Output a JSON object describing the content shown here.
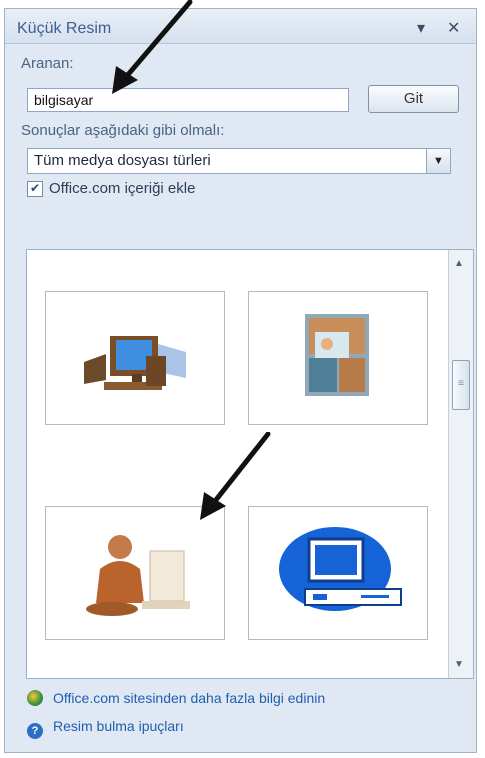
{
  "pane": {
    "title": "Küçük Resim",
    "dropdown_icon": "triangle-down-icon",
    "close_icon": "close-icon"
  },
  "search": {
    "label": "Aranan:",
    "value": "bilgisayar",
    "go_label": "Git"
  },
  "results_filter": {
    "label": "Sonuçlar aşağıdaki gibi olmalı:",
    "selected": "Tüm medya dosyası türleri"
  },
  "include_office": {
    "label": "Office.com içeriği ekle",
    "checked": true
  },
  "results": [
    {
      "icon": "desktop-computer-clipart"
    },
    {
      "icon": "computer-collage-clipart"
    },
    {
      "icon": "person-at-computer-clipart"
    },
    {
      "icon": "blue-computer-clipart"
    }
  ],
  "links": {
    "office_more": "Office.com sitesinden daha fazla bilgi edinin",
    "tips": "Resim bulma ipuçları"
  },
  "colors": {
    "accent": "#1f5fb0",
    "pane_bg": "#dfe8f3"
  }
}
